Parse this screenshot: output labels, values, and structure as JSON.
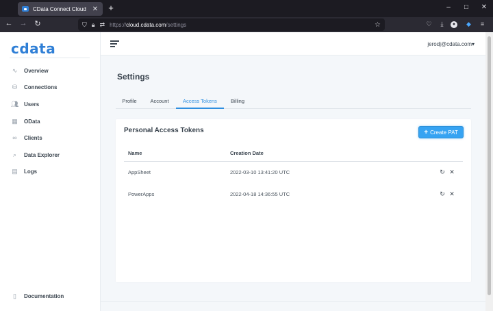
{
  "browser": {
    "tab_title": "CData Connect Cloud",
    "tab_close": "✕",
    "new_tab": "+",
    "url_prefix": "https://",
    "url_domain": "cloud.cdata.com",
    "url_path": "/settings",
    "window_buttons": [
      "–",
      "□",
      "✕"
    ]
  },
  "sidebar": {
    "logo": "cdata",
    "items": [
      {
        "label": "Overview",
        "icon": "pulse-icon"
      },
      {
        "label": "Connections",
        "icon": "database-icon"
      },
      {
        "label": "Users",
        "icon": "users-icon"
      },
      {
        "label": "OData",
        "icon": "grid-icon"
      },
      {
        "label": "Clients",
        "icon": "link-icon"
      },
      {
        "label": "Data Explorer",
        "icon": "search-icon"
      },
      {
        "label": "Logs",
        "icon": "document-icon"
      }
    ],
    "bottom_item": {
      "label": "Documentation",
      "icon": "book-icon"
    }
  },
  "header": {
    "user": "jerodj@cdata.com",
    "user_caret": "▾"
  },
  "settings": {
    "title": "Settings",
    "tabs": [
      "Profile",
      "Account",
      "Access Tokens",
      "Billing"
    ],
    "active_tab": "Access Tokens"
  },
  "tokens": {
    "title": "Personal Access Tokens",
    "create_label": "Create PAT",
    "create_plus": "+",
    "columns": [
      "Name",
      "Creation Date"
    ],
    "rows": [
      {
        "name": "AppSheet",
        "created": "2022-03-10 13:41:20 UTC"
      },
      {
        "name": "PowerApps",
        "created": "2022-04-18 14:36:55 UTC"
      }
    ],
    "refresh_glyph": "↻",
    "delete_glyph": "✕"
  },
  "colors": {
    "accent": "#2f8fe0",
    "button": "#36a3f2",
    "logo": "#2f7fd6"
  }
}
